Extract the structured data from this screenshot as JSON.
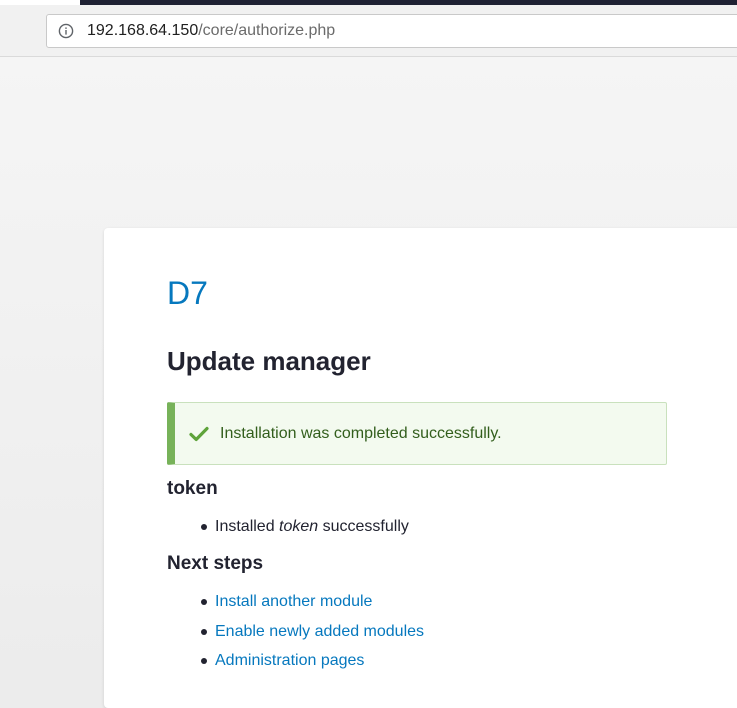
{
  "browser": {
    "address_host": "192.168.64.150",
    "address_path": "/core/authorize.php",
    "icon": "info-icon"
  },
  "site": {
    "name": "D7"
  },
  "page": {
    "title": "Update manager"
  },
  "status_message": {
    "icon": "check-icon",
    "text": "Installation was completed successfully.",
    "accent_color": "#77b259"
  },
  "module_section": {
    "heading": "token",
    "item_prefix": "Installed ",
    "item_name": "token",
    "item_suffix": " successfully"
  },
  "next_steps": {
    "heading": "Next steps",
    "links": [
      "Install another module",
      "Enable newly added modules",
      "Administration pages"
    ]
  },
  "colors": {
    "link": "#0678be",
    "text": "#222330",
    "success_bg": "#f3faef"
  }
}
